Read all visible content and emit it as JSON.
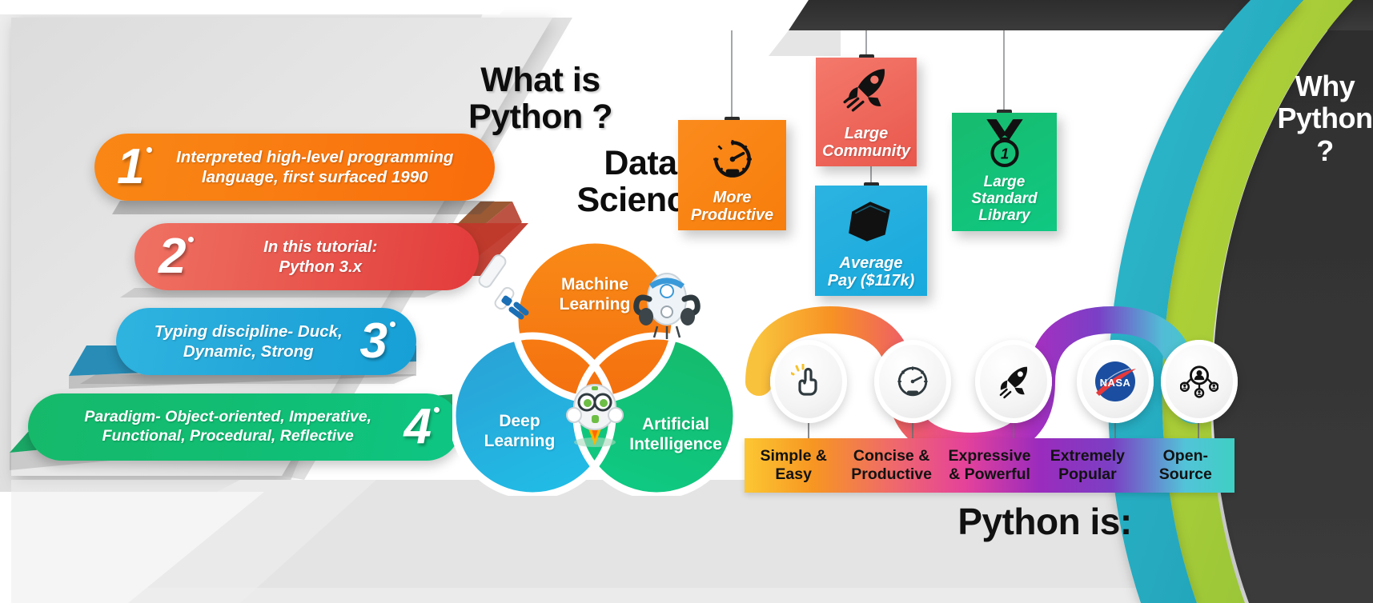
{
  "headings": {
    "what_is_python": "What is\nPython ?",
    "what_is_python_l1": "What is",
    "what_is_python_l2": "Python ?",
    "data_science_l1": "Data",
    "data_science_l2": "Science",
    "why_python_l1": "Why",
    "why_python_l2": "Python",
    "why_python_l3": "?",
    "python_is": "Python is:"
  },
  "ribbons": [
    {
      "number": "1",
      "text_l1": "Interpreted high-level programming",
      "text_l2": "language, first surfaced 1990",
      "color": "#f97d12"
    },
    {
      "number": "2",
      "text_l1": "In this tutorial:",
      "text_l2": "Python 3.x",
      "color": "#e8544b"
    },
    {
      "number": "3",
      "text_l1": "Typing discipline- Duck,",
      "text_l2": "Dynamic, Strong",
      "color": "#22a6d9"
    },
    {
      "number": "4",
      "text_l1": "Paradigm- Object-oriented, Imperative,",
      "text_l2": "Functional, Procedural, Reflective",
      "color": "#11bd73"
    }
  ],
  "venn": {
    "machine_learning_l1": "Machine",
    "machine_learning_l2": "Learning",
    "deep_learning_l1": "Deep",
    "deep_learning_l2": "Learning",
    "artificial_intelligence_l1": "Artificial",
    "artificial_intelligence_l2": "Intelligence",
    "colors": {
      "machine_learning": "#f4700f",
      "deep_learning": "#22a6d9",
      "artificial_intelligence": "#0ecb86"
    }
  },
  "cards": [
    {
      "id": "more-productive",
      "icon": "speedometer-icon",
      "label_l1": "More",
      "label_l2": "Productive",
      "label_l3": "",
      "color": "#f77d0b"
    },
    {
      "id": "large-community",
      "icon": "rocket-icon",
      "label_l1": "Large",
      "label_l2": "Community",
      "label_l3": "",
      "color": "#e9574c"
    },
    {
      "id": "average-pay",
      "icon": "money-bill-icon",
      "label_l1": "Average",
      "label_l2": "Pay ($117k)",
      "label_l3": "",
      "color": "#18a9dd"
    },
    {
      "id": "large-standard-library",
      "icon": "medal-icon",
      "label_l1": "Large",
      "label_l2": "Standard",
      "label_l3": "Library",
      "color": "#0fc882"
    }
  ],
  "wave": {
    "nodes": [
      {
        "icon": "click-hand-icon",
        "label_l1": "Simple &",
        "label_l2": "Easy",
        "color": "#f9b931"
      },
      {
        "icon": "speedometer-icon",
        "label_l1": "Concise &",
        "label_l2": "Productive",
        "color": "#f5823a"
      },
      {
        "icon": "rocket-icon",
        "label_l1": "Expressive",
        "label_l2": "& Powerful",
        "color": "#e8508a"
      },
      {
        "icon": "nasa-logo-icon",
        "label_l1": "Extremely",
        "label_l2": "Popular",
        "color": "#8b2bbd"
      },
      {
        "icon": "network-users-icon",
        "label_l1": "Open-",
        "label_l2": "Source",
        "color": "#3ec9c9"
      }
    ],
    "bar_gradient": [
      "#fcc733",
      "#f79622",
      "#ef6a6a",
      "#e5429a",
      "#9b2bbd",
      "#7b3fc4",
      "#52c4d8",
      "#3fcfc4"
    ]
  },
  "background": {
    "panel_dark": "#333333",
    "arc_green": "#a9cf38",
    "arc_teal": "#29b0c4",
    "panel_light": "#e2e2e2"
  }
}
